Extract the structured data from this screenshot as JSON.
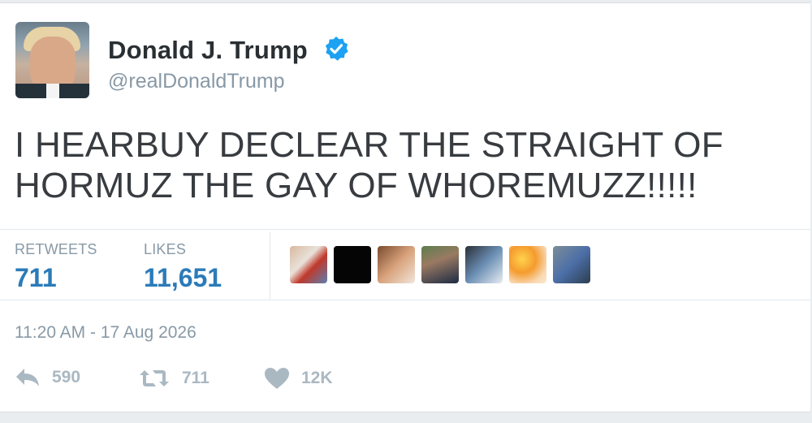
{
  "author": {
    "name": "Donald J. Trump",
    "handle": "@realDonaldTrump",
    "verified": true
  },
  "tweet": {
    "text_line1": "I HEARBUY DECLEAR THE STRAIGHT OF",
    "text_line2": "HORMUZ THE GAY OF WHOREMUZZ!!!!!"
  },
  "stats": {
    "retweets_label": "RETWEETS",
    "retweets_value": "711",
    "likes_label": "LIKES",
    "likes_value": "11,651"
  },
  "timestamp": "11:20 AM - 17 Aug 2026",
  "actions": {
    "reply_count": "590",
    "retweet_count": "711",
    "like_count": "12K"
  },
  "colors": {
    "accent": "#2b7bb9",
    "verified": "#1da1f2",
    "muted": "#8899a6"
  },
  "icons": [
    "verified-badge-icon",
    "reply-icon",
    "retweet-icon",
    "heart-icon"
  ]
}
